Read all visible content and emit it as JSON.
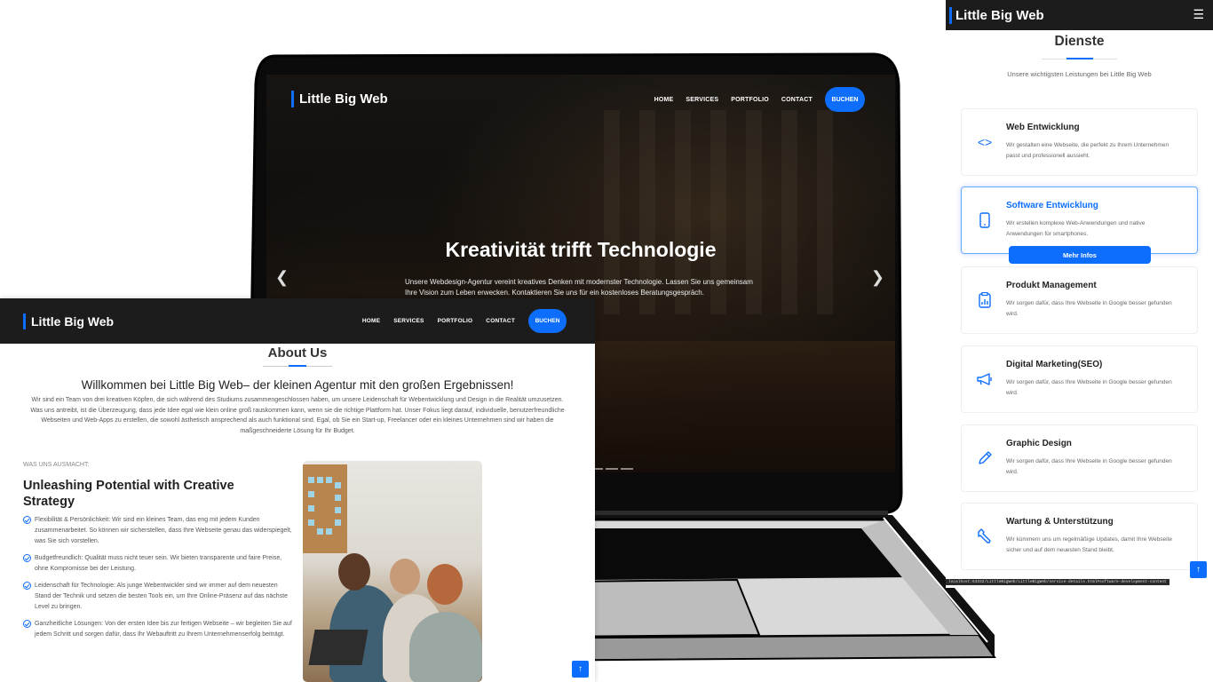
{
  "hero": {
    "brand": "Little Big Web",
    "nav": [
      "HOME",
      "SERVICES",
      "PORTFOLIO",
      "CONTACT"
    ],
    "cta": "BUCHEN",
    "headline": "Kreativität trifft Technologie",
    "lead": "Unsere Webdesign-Agentur vereint kreatives Denken mit modernster Technologie. Lassen Sie uns gemeinsam Ihre Vision zum Leben erwecken. Kontaktieren Sie uns für ein kostenloses Beratungsgespräch.",
    "prev_icon": "chevron-left-icon",
    "next_icon": "chevron-right-icon"
  },
  "about": {
    "brand": "Little Big Web",
    "nav": [
      "HOME",
      "SERVICES",
      "PORTFOLIO",
      "CONTACT"
    ],
    "cta": "BUCHEN",
    "title": "About Us",
    "welcome": "Willkommen bei Little Big Web– der kleinen Agentur mit den großen Ergebnissen!",
    "intro": "Wir sind ein Team von drei kreativen Köpfen, die sich während des Studiums zusammengeschlossen haben, um unsere Leidenschaft für Webentwicklung und Design in die Realität umzusetzen. Was uns antreibt, ist die Überzeugung, dass jede Idee egal wie klein online groß rauskommen kann, wenn sie die richtige Plattform hat. Unser Fokus liegt darauf, individuelle, benutzerfreundliche Webseiten und Web-Apps zu erstellen, die sowohl ästhetisch ansprechend als auch funktional sind. Egal, ob Sie ein Start-up, Freelancer oder ein kleines Unternehmen sind wir haben die maßgeschneiderte Lösung für Ihr Budget.",
    "eyebrow": "WAS UNS AUSMACHT:",
    "heading": "Unleashing Potential with Creative Strategy",
    "features": [
      "Flexibilität & Persönlichkeit: Wir sind ein kleines Team, das eng mit jedem Kunden zusammenarbeitet. So können wir sicherstellen, dass Ihre Webseite genau das widerspiegelt, was Sie sich vorstellen.",
      "Budgetfreundlich: Qualität muss nicht teuer sein. Wir bieten transparente und faire Preise, ohne Kompromisse bei der Leistung.",
      "Leidenschaft für Technologie: Als junge Webentwickler sind wir immer auf dem neuesten Stand der Technik und setzen die besten Tools ein, um Ihre Online-Präsenz auf das nächste Level zu bringen.",
      "Ganzheitliche Lösungen: Von der ersten Idee bis zur fertigen Webseite – wir begleiten Sie auf jedem Schritt und sorgen dafür, dass Ihr Webauftritt zu Ihrem Unternehmenserfolg beiträgt."
    ],
    "scroll_icon": "arrow-up-icon"
  },
  "services": {
    "brand": "Little Big Web",
    "menu_icon": "hamburger-menu-icon",
    "title": "Dienste",
    "subtitle": "Unsere wichtigsten Leistungen bei Little Big Web",
    "items": [
      {
        "title": "Web Entwicklung",
        "desc": "Wir gestalten eine Webseite, die perfekt zu Ihrem Unternehmen passt und professionell aussieht.",
        "icon": "code-icon"
      },
      {
        "title": "Software Entwicklung",
        "desc": "Wir erstellen komplexe Web-Anwendungen und native Anwendungen für smartphones.",
        "icon": "smartphone-icon",
        "button": "Mehr Infos"
      },
      {
        "title": "Produkt Management",
        "desc": "Wir sorgen dafür, dass Ihre Webseite in Google besser gefunden wird.",
        "icon": "clipboard-chart-icon"
      },
      {
        "title": "Digital Marketing(SEO)",
        "desc": "Wir sorgen dafür, dass Ihre Webseite in Google besser gefunden wird.",
        "icon": "megaphone-icon"
      },
      {
        "title": "Graphic Design",
        "desc": "Wir sorgen dafür, dass Ihre Webseite in Google besser gefunden wird.",
        "icon": "pencil-icon"
      },
      {
        "title": "Wartung & Unterstützung",
        "desc": "Wir kümmern uns um regelmäßige Updates, damit Ihre Webseite sicher und auf dem neuesten Stand bleibt.",
        "icon": "wrench-icon"
      }
    ],
    "status_url": "localhost:63342/LittleBigWeb/LittleBigWeb/service-details.html#software-development-content",
    "scroll_icon": "arrow-up-icon"
  },
  "colors": {
    "accent": "#0d6efd",
    "nav_bg": "#1c1c1c"
  }
}
